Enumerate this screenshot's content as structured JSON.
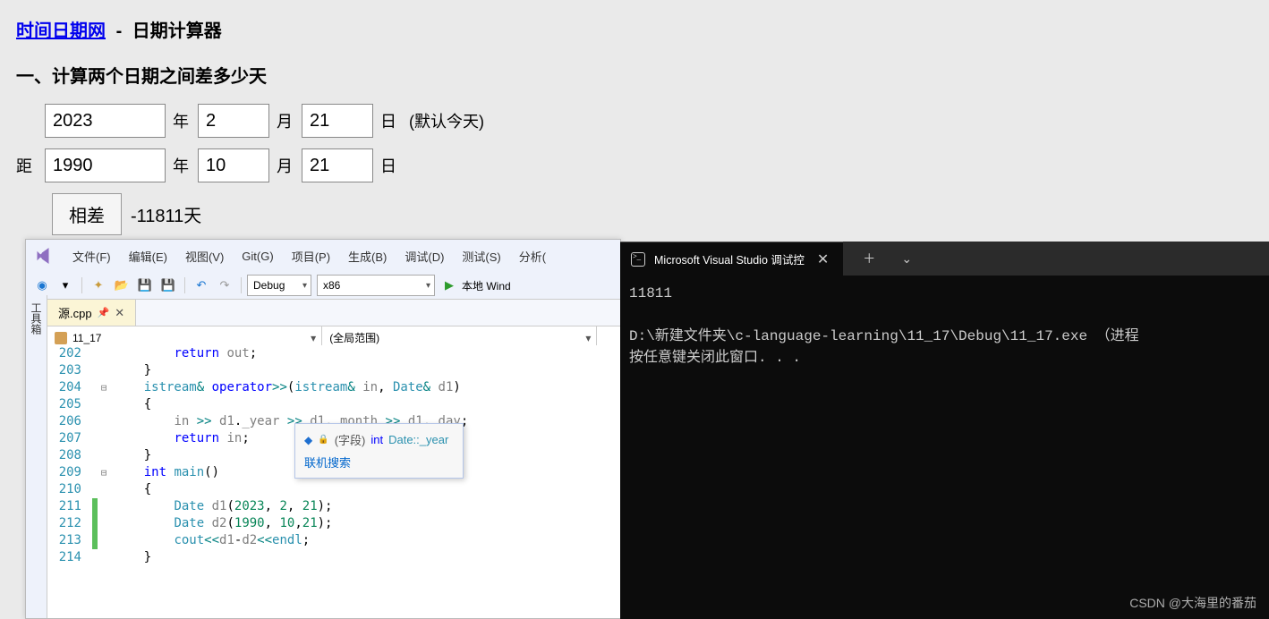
{
  "web": {
    "site_link": "时间日期网",
    "page_title": "日期计算器",
    "section_heading": "一、计算两个日期之间差多少天",
    "row1": {
      "prefix": "",
      "year": "2023",
      "ylabel": "年",
      "month": "2",
      "mlabel": "月",
      "day": "21",
      "dlabel": "日",
      "hint": "(默认今天)"
    },
    "row2": {
      "prefix": "距",
      "year": "1990",
      "ylabel": "年",
      "month": "10",
      "mlabel": "月",
      "day": "21",
      "dlabel": "日"
    },
    "diff_btn": "相差",
    "result": "-11811天"
  },
  "vs": {
    "menu": [
      "文件(F)",
      "编辑(E)",
      "视图(V)",
      "Git(G)",
      "项目(P)",
      "生成(B)",
      "调试(D)",
      "测试(S)",
      "分析("
    ],
    "config": "Debug",
    "platform": "x86",
    "run_label": "本地 Wind",
    "sidebar": "工具箱",
    "tab": "源.cpp",
    "nav_left": "11_17",
    "nav_right": "(全局范围)",
    "lines": [
      {
        "n": 202,
        "code": "        return out;"
      },
      {
        "n": 203,
        "code": "    }"
      },
      {
        "n": 204,
        "code": "    istream& operator>>(istream& in, Date& d1)",
        "fold": "⊟"
      },
      {
        "n": 205,
        "code": "    {"
      },
      {
        "n": 206,
        "code": "        in >> d1._year >> d1._month >> d1._day;"
      },
      {
        "n": 207,
        "code": "        return in;"
      },
      {
        "n": 208,
        "code": "    }"
      },
      {
        "n": 209,
        "code": "    int main()",
        "fold": "⊟"
      },
      {
        "n": 210,
        "code": "    {"
      },
      {
        "n": 211,
        "code": "        Date d1(2023, 2, 21);",
        "chg": true
      },
      {
        "n": 212,
        "code": "        Date d2(1990, 10,21);",
        "chg": true
      },
      {
        "n": 213,
        "code": "        cout<<d1-d2<<endl;",
        "chg": true
      },
      {
        "n": 214,
        "code": "    }"
      }
    ],
    "tooltip": {
      "field_label": "(字段)",
      "type": "int",
      "name": "Date::_year",
      "search": "联机搜索"
    }
  },
  "console": {
    "title": "Microsoft Visual Studio 调试控",
    "output": "11811\n\nD:\\新建文件夹\\c-language-learning\\11_17\\Debug\\11_17.exe （进程\n按任意键关闭此窗口. . ."
  },
  "watermark": "CSDN @大海里的番茄"
}
